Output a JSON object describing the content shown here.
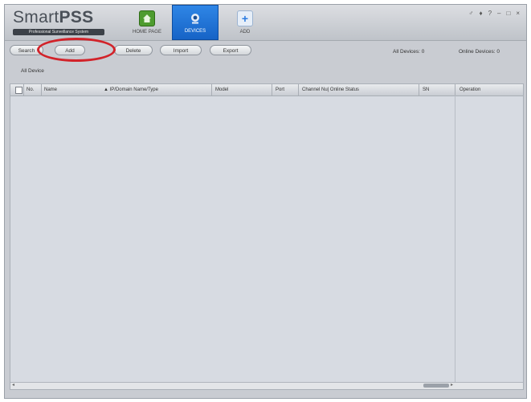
{
  "app": {
    "logo_main": "Smart",
    "logo_bold": "PSS",
    "logo_sub": "Professional Surveillance System",
    "window_controls": [
      "♂",
      "♦",
      "?",
      "–",
      "□",
      "×"
    ]
  },
  "tabs": [
    {
      "label": "HOME PAGE",
      "icon": "home-icon"
    },
    {
      "label": "DEVICES",
      "icon": "devices-icon"
    },
    {
      "label": "ADD",
      "icon": "plus-icon"
    }
  ],
  "toolbar": {
    "search_label": "Search",
    "add_label": "Add",
    "delete_label": "Delete",
    "import_label": "Import",
    "export_label": "Export"
  },
  "counts": {
    "all_devices": "All Devices:  0",
    "online_devices": "Online Devices:  0"
  },
  "breadcrumb": "All Device",
  "table": {
    "columns": [
      "No.",
      "Name",
      "▲ IP/Domain Name/Type",
      "Model",
      "Port",
      "Channel Nu| Online Status",
      "SN",
      "Operation"
    ]
  },
  "colors": {
    "accent": "#1663c6",
    "highlight_ring": "#d2232a",
    "home_icon": "#4e9c2f"
  }
}
